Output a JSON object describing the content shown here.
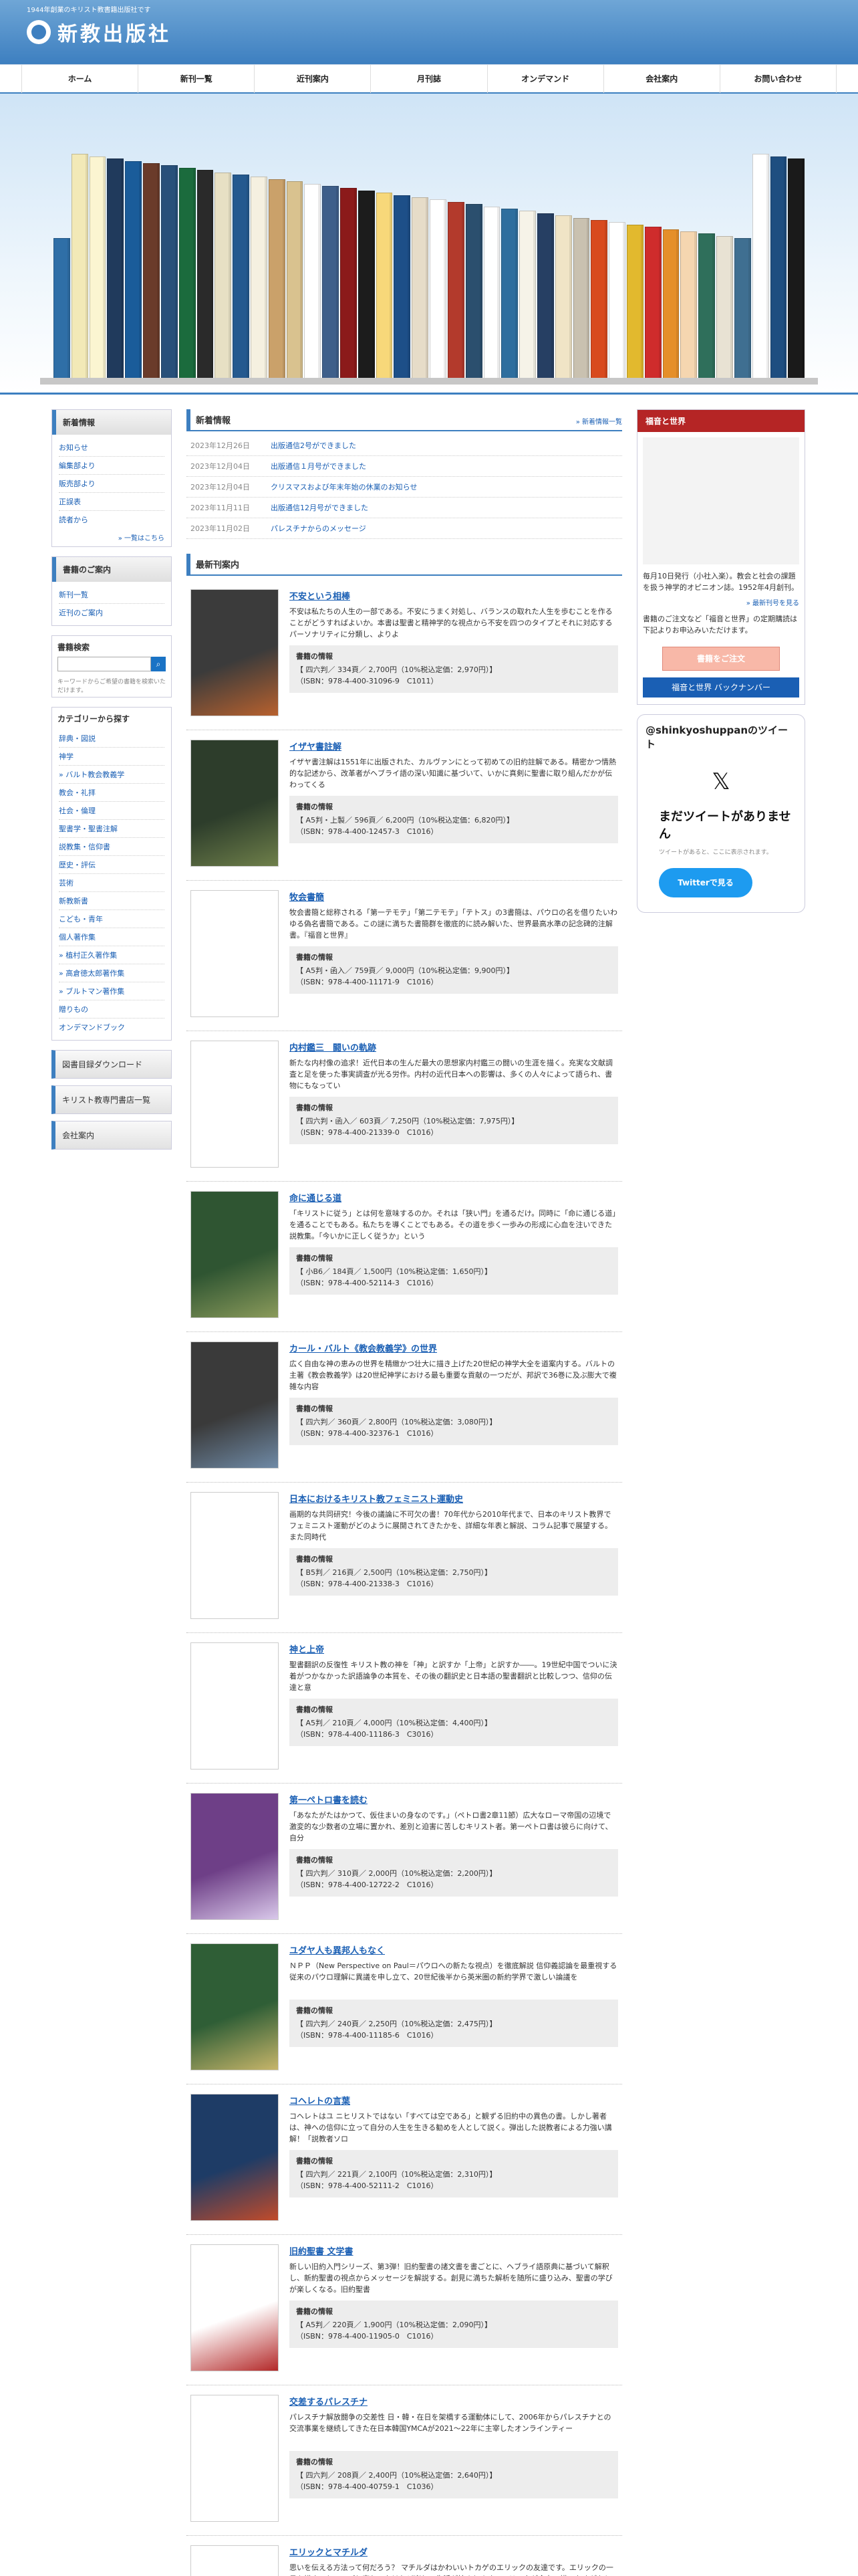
{
  "header": {
    "tagline": "1944年創業のキリスト教書籍出版社です",
    "logo_text": "新教出版社"
  },
  "gnav": [
    "ホーム",
    "新刊一覧",
    "近刊案内",
    "月刊誌",
    "オンデマンド",
    "会社案内",
    "お問い合わせ"
  ],
  "sidebar": {
    "news_head": "新着情報",
    "news_items": [
      "お知らせ",
      "編集部より",
      "販売部より",
      "正誤表",
      "読者から"
    ],
    "news_more": "一覧はこちら",
    "books_head": "書籍のご案内",
    "books_items": [
      "新刊一覧",
      "近刊のご案内"
    ],
    "search_label": "書籍検索",
    "search_hint": "キーワードからご希望の書籍を検索いただけます。",
    "cat_head": "カテゴリーから探す",
    "cats": [
      "辞典・図説",
      "神学",
      "聖書・注解",
      "教会・礼拝",
      "社会・倫理",
      "聖書学・聖書注解",
      "説教集・信仰書",
      "歴史・評伝",
      "芸術",
      "新教新書",
      "こども・青年",
      "個人著作集",
      "贈りもの",
      "オンデマンドブック"
    ],
    "cat_sub1": "バルト教会教義学",
    "cat_sub2": [
      "植村正久著作集",
      "高倉徳太郎著作集",
      "ブルトマン著作集"
    ],
    "nav_buttons": [
      "図書目録ダウンロード",
      "キリスト教専門書店一覧",
      "会社案内"
    ]
  },
  "center": {
    "news_title": "新着情報",
    "news_more": "新着情報一覧",
    "news": [
      {
        "date": "2023年12月26日",
        "title": "出版通信2号ができました"
      },
      {
        "date": "2023年12月04日",
        "title": "出版通信１月号ができました"
      },
      {
        "date": "2023年12月04日",
        "title": "クリスマスおよび年末年始の休業のお知らせ"
      },
      {
        "date": "2023年11月11日",
        "title": "出版通信12月号ができました"
      },
      {
        "date": "2023年11月02日",
        "title": "パレスチナからのメッセージ"
      }
    ],
    "books_title": "最新刊案内",
    "spec_label": "書籍の情報",
    "books": [
      {
        "title": "不安という相棒",
        "desc": "不安は私たちの人生の一部である。不安にうまく対処し、バランスの取れた人生を歩むことを作ることがどうすればよいか。本書は聖書と精神学的な視点から不安を四つのタイプとそれに対応するパーソナリティに分類し、よりよ",
        "spec1": "【 四六判／ 334頁／ 2,700円（10%税込定価：2,970円）】",
        "spec2": "（ISBN：978-4-400-31096-9　C1011）",
        "c1": "#3b3b3b",
        "c2": "#b8612e"
      },
      {
        "title": "イザヤ書註解",
        "desc": "イザヤ書注解は1551年に出版された、カルヴァンにとって初めての旧約註解である。精密かつ情熱的な記述から、改革者がヘブライ語の深い知識に基づいて、いかに真剣に聖書に取り組んだかが伝わってくる",
        "spec1": "【 A5判・上製／ 596頁／ 6,200円（10%税込定価：6,820円）】",
        "spec2": "（ISBN：978-4-400-12457-3　C1016）",
        "c1": "#2d3d2b",
        "c2": "#6e7f4a"
      },
      {
        "title": "牧会書簡",
        "desc": "牧会書簡と総称される「第一テモテ」「第二テモテ」「テトス」の3書簡は、パウロの名を借りたいわゆる偽名書簡である。この謎に満ちた書簡群を徹底的に読み解いた、世界最高水準の記念碑的注解書。『福音と世界』",
        "spec1": "【 A5判・函入／ 759頁／ 9,000円（10%税込定価：9,900円）】",
        "spec2": "（ISBN：978-4-400-11171-9　C1016）",
        "c1": "#ffffff",
        "c2": "#ffffff"
      },
      {
        "title": "内村鑑三　闘いの軌跡",
        "desc": "新たな内村像の追求！近代日本の生んだ最大の思想家内村鑑三の闘いの生涯を描く。充実な文献調査と足を使った事実調査が光る労作。内村の近代日本への影響は、多くの人々によって語られ、書物にもなってい",
        "spec1": "【 四六判・函入／ 603頁／ 7,250円（10%税込定価：7,975円）】",
        "spec2": "（ISBN：978-4-400-21339-0　C1016）",
        "c1": "#ffffff",
        "c2": "#ffffff"
      },
      {
        "title": "命に通じる道",
        "desc": "「キリストに従う」とは何を意味するのか。それは「狭い門」を通るだけ。同時に「命に通じる道」を通ることでもある。私たちを導くことでもある。その道を歩く一歩みの形成に心血を注いできた説教集。「今いかに正しく従うか」という",
        "spec1": "【 小B6／ 184頁／ 1,500円（10%税込定価：1,650円）】",
        "spec2": "（ISBN：978-4-400-52114-3　C1016）",
        "c1": "#2f5532",
        "c2": "#8a9a5b"
      },
      {
        "title": "カール・バルト《教会教義学》の世界",
        "desc": "広く自由な神の恵みの世界を精緻かつ壮大に描き上げた20世紀の神学大全を道案内する。バルトの主著《教会教義学》は20世紀神学における最も重要な貢献の一つだが、邦訳で36巻に及ぶ膨大で複雑な内容",
        "spec1": "【 四六判／ 360頁／ 2,800円（10%税込定価：3,080円）】",
        "spec2": "（ISBN：978-4-400-32376-1　C1016）",
        "c1": "#3a3a3a",
        "c2": "#6f8aa6"
      },
      {
        "title": "日本におけるキリスト教フェミニスト運動史",
        "desc": "画期的な共同研究！今後の議論に不可欠の書！70年代から2010年代まで、日本のキリスト教界でフェミニスト運動がどのように展開されてきたかを、詳細な年表と解説、コラム記事で展望する。また同時代",
        "spec1": "【 B5判／ 216頁／ 2,500円（10%税込定価：2,750円）】",
        "spec2": "（ISBN：978-4-400-21338-3　C1016）",
        "c1": "#ffffff",
        "c2": "#ffffff"
      },
      {
        "title": "神と上帝",
        "desc": "聖書翻訳の反復性 キリスト教の神を「神」と訳すか「上帝」と訳すか――。19世紀中国でついに決着がつかなかった訳語論争の本質を、その後の翻訳史と日本語の聖書翻訳と比較しつつ、信仰の伝達と意",
        "spec1": "【 A5判／ 210頁／ 4,000円（10%税込定価：4,400円）】",
        "spec2": "（ISBN：978-4-400-11186-3　C3016）",
        "c1": "#ffffff",
        "c2": "#ffffff"
      },
      {
        "title": "第一ペトロ書を読む",
        "desc": "「あなたがたはかつて、仮住まいの身なのです。」（ペトロ書2章11節）広大なローマ帝国の辺境で激変的な少数者の立場に置かれ、差別と迫害に苦しむキリスト者。第一ペトロ書は彼らに向けて、自分",
        "spec1": "【 四六判／ 310頁／ 2,000円（10%税込定価：2,200円）】",
        "spec2": "（ISBN：978-4-400-12722-2　C1016）",
        "c1": "#6e3f87",
        "c2": "#d9c8ea"
      },
      {
        "title": "ユダヤ人も異邦人もなく",
        "desc": "ＮＰＰ（New Perspective on Paul＝パウロへの新たな視点）を徹底解説 信仰義認論を最重視する従来のパウロ理解に異議を申し立て、20世紀後半から英米圏の新約学界で激しい論議を",
        "spec1": "【 四六判／ 240頁／ 2,250円（10%税込定価：2,475円）】",
        "spec2": "（ISBN：978-4-400-11185-6　C1016）",
        "c1": "#2f5e36",
        "c2": "#c7b56a"
      },
      {
        "title": "コヘレトの言葉",
        "desc": "コヘレトはユ ニヒリストではない「すべては空である」と観ずる旧約中の異色の書。しかし著者は、神への信仰に立って自分の人生を生きる勧めを人として説く。弾出した説教者による力強い講解！「説教者ソロ",
        "spec1": "【 四六判／ 221頁／ 2,100円（10%税込定価：2,310円）】",
        "spec2": "（ISBN：978-4-400-52111-2　C1016）",
        "c1": "#1e3c66",
        "c2": "#c24b2a"
      },
      {
        "title": "旧約聖書 文学書",
        "desc": "新しい旧約入門シリーズ、第3弾！旧約聖書の諸文書を書ごとに、ヘブライ語原典に基づいて解釈し、新約聖書の視点からメッセージを解説する。創見に満ちた解析を随所に盛り込み、聖書の学びが楽しくなる。旧約聖書",
        "spec1": "【 A5判／ 220頁／ 1,900円（10%税込定価：2,090円）】",
        "spec2": "（ISBN：978-4-400-11905-0　C1016）",
        "c1": "#ffffff",
        "c2": "#b32828"
      },
      {
        "title": "交差するパレスチナ",
        "desc": "パレスチナ解放闘争の交差性 日・韓・在日を架橋する運動体にして、2006年からパレスチナとの交流事業を継続してきた在日本韓国YMCAが2021～22年に主宰したオンラインティー",
        "spec1": "【 四六判／ 208頁／ 2,400円（10%税込定価：2,640円）】",
        "spec2": "（ISBN：978-4-400-40759-1　C1036）",
        "c1": "#ffffff",
        "c2": "#ffffff"
      },
      {
        "title": "エリックとマチルダ",
        "desc": "思いを伝える方法って何だろう？ マチルダはかわいいトカゲのエリックの友達です。エリックの一日を描き、ちょっぴり変わったけれど楽しい生活が始まります。エリックが全力で描いたすがたとは？",
        "spec1": "",
        "spec2": "",
        "c1": "#ffffff",
        "c2": "#ffffff"
      }
    ]
  },
  "right": {
    "head": "福音と世界",
    "text": "毎月10日発行（小社入楽）。教会と社会の課題を扱う神学的オピニオン誌。1952年4月創刊。",
    "link": "最新刊号を見る",
    "text2": "書籍のご注文など「福音と世界」の定期購読は下記よりお申込みいただけます。",
    "order": "書籍をご注文",
    "backnum": "福音と世界 バックナンバー",
    "tw_handle": "@shinkyoshuppanのツイート",
    "tw_msg": "まだツイートがありません",
    "tw_sub": "ツイートがあると、ここに表示されます。",
    "tw_btn": "Twitterで見る"
  },
  "shelf_colors": [
    "#2f6fa7",
    "#f2e9b7",
    "#fbf5d1",
    "#203a5c",
    "#1a5c9a",
    "#6a3b2a",
    "#28507a",
    "#1b6b3d",
    "#2a2a2a",
    "#e7e0c4",
    "#24598f",
    "#f5f0e0",
    "#caa16a",
    "#d9c28f",
    "#ffffff",
    "#3e5f8a",
    "#8b1a1a",
    "#1c1c1c",
    "#f7d87a",
    "#1d4f88",
    "#e6dcc8",
    "#ffffff",
    "#b33a2c",
    "#2b4f6e",
    "#ffffff",
    "#2e6e9e",
    "#f6f3e8",
    "#263f63",
    "#f0e4c6",
    "#c9c1b0",
    "#d84a1e",
    "#ffffff",
    "#e2b92e",
    "#cf2c2c",
    "#e58f2a",
    "#f5d6b0",
    "#2f6f5b",
    "#e8e2d3",
    "#3f6f91",
    "#ffffff",
    "#1e4e80",
    "#1a1a1a"
  ]
}
